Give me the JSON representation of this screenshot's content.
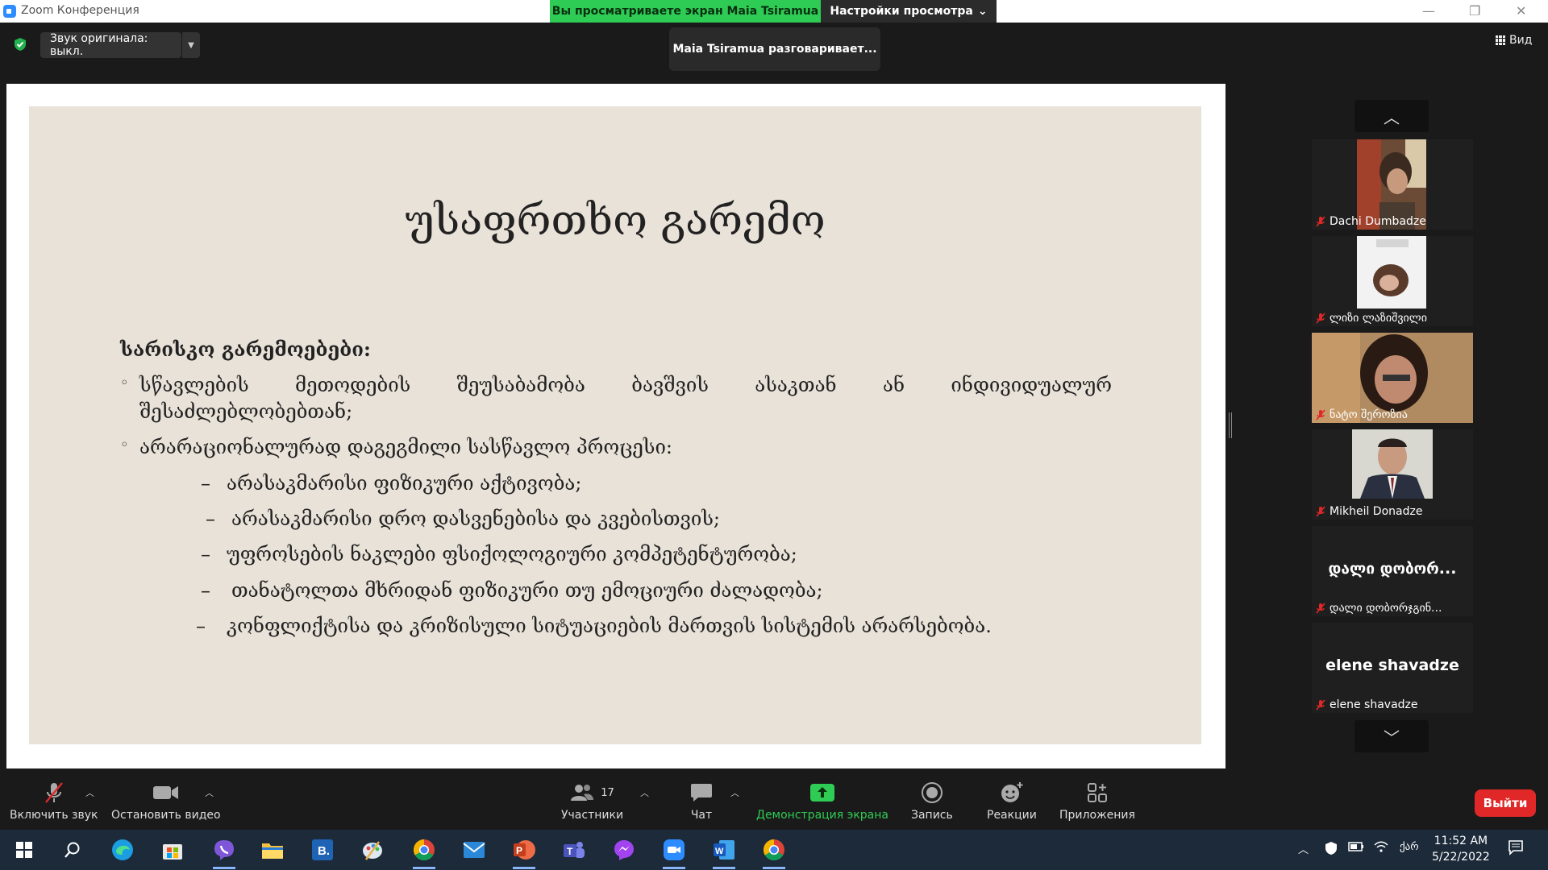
{
  "window": {
    "title": "Zoom Конференция",
    "share_banner": "Вы просматриваете экран Maia Tsiramua",
    "view_settings": "Настройки просмотра"
  },
  "top": {
    "original_sound": "Звук оригинала: выкл.",
    "speaking": "Maia Tsiramua разговаривает...",
    "view_label": "Вид"
  },
  "slide": {
    "title": "უსაფრთხო გარემო",
    "heading": "სარისკო გარემოებები:",
    "bullet1_line1": "სწავლების მეთოდების შეუსაბამობა ბავშვის ასაკთან ან ინდივიდუალურ",
    "bullet1_line2": "შესაძლებლობებთან;",
    "bullet2": "არარაციონალურად დაგეგმილი სასწავლო პროცესი:",
    "subitems": [
      "არასაკმარისი ფიზიკური აქტივობა;",
      "არასაკმარისი დრო დასვენებისა და კვებისთვის;",
      "უფროსების ნაკლები ფსიქოლოგიური კომპეტენტურობა;",
      "თანატოლთა მხრიდან ფიზიკური თუ ემოციური ძალადობა;",
      "კონფლიქტისა და კრიზისული სიტუაციების მართვის სისტემის არარსებობა."
    ]
  },
  "participants_gallery": [
    {
      "name": "Dachi Dumbadze",
      "has_video": true
    },
    {
      "name": "ლიზი ლაზიშვილი",
      "has_video": true
    },
    {
      "name": "ნატო შეროზია",
      "has_video": true
    },
    {
      "name": "Mikheil Donadze",
      "has_video": true
    },
    {
      "name": "დალი დობორჯგინ...",
      "display": "დალი დობორ...",
      "has_video": false
    },
    {
      "name": "elene shavadze",
      "display": "elene shavadze",
      "has_video": false
    }
  ],
  "controls": {
    "unmute": "Включить звук",
    "stop_video": "Остановить видео",
    "participants": "Участники",
    "participants_count": "17",
    "chat": "Чат",
    "share_screen": "Демонстрация экрана",
    "record": "Запись",
    "reactions": "Реакции",
    "apps": "Приложения",
    "leave": "Выйти"
  },
  "taskbar": {
    "time": "11:52 AM",
    "date": "5/22/2022",
    "lang": "ქარ"
  },
  "colors": {
    "share_green": "#2ecc55",
    "slide_bg": "#e9e2d8",
    "leave_red": "#e02828",
    "taskbar": "#1c2a3a"
  }
}
